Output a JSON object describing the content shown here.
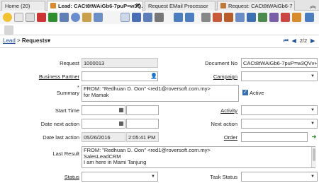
{
  "tabs": [
    {
      "label": "Home (20)",
      "active": false
    },
    {
      "label": "Lead: CACt8tWAiGb6-7puP=w3Q...",
      "active": true
    },
    {
      "label": "Request EMail Processor",
      "active": false
    },
    {
      "label": "Request: CACt8tWAiGb6-7",
      "active": false
    }
  ],
  "breadcrumb": {
    "root": "Lead",
    "separator": " > ",
    "current": "Requests",
    "caret": "▾"
  },
  "record_nav": {
    "position": "2/2"
  },
  "form": {
    "request": {
      "label": "Request",
      "value": "1000013"
    },
    "document_no": {
      "label": "Document No",
      "value": "CACt8tWAiGb6-7puP=w3QVv+ui"
    },
    "business_partner": {
      "label": "Business Partner",
      "value": ""
    },
    "campaign": {
      "label": "Campaign",
      "value": ""
    },
    "summary": {
      "label": "Summary",
      "required_mark": "*",
      "value": "FROM: \"Redhuan D. Oon\" <red1@roversoft.com.my>\nfor Mamak"
    },
    "active": {
      "label": "Active",
      "checked": true
    },
    "start_time": {
      "label": "Start Time",
      "date": "",
      "time": ""
    },
    "activity": {
      "label": "Activity",
      "value": ""
    },
    "date_next_action": {
      "label": "Date next action",
      "date": "",
      "time": ""
    },
    "next_action": {
      "label": "Next action",
      "value": ""
    },
    "date_last_action": {
      "label": "Date last action",
      "date": "05/26/2016",
      "time": "2:05:41 PM"
    },
    "order": {
      "label": "Order",
      "value": ""
    },
    "last_result": {
      "label": "Last Result",
      "value": "FROM: \"Redhuan D. Oon\" <red1@roversoft.com.my>\nSalesLeadCRM\nI am here in Mami Tanjung"
    },
    "status": {
      "label": "Status",
      "value": ""
    },
    "task_status": {
      "label": "Task Status",
      "value": ""
    }
  }
}
